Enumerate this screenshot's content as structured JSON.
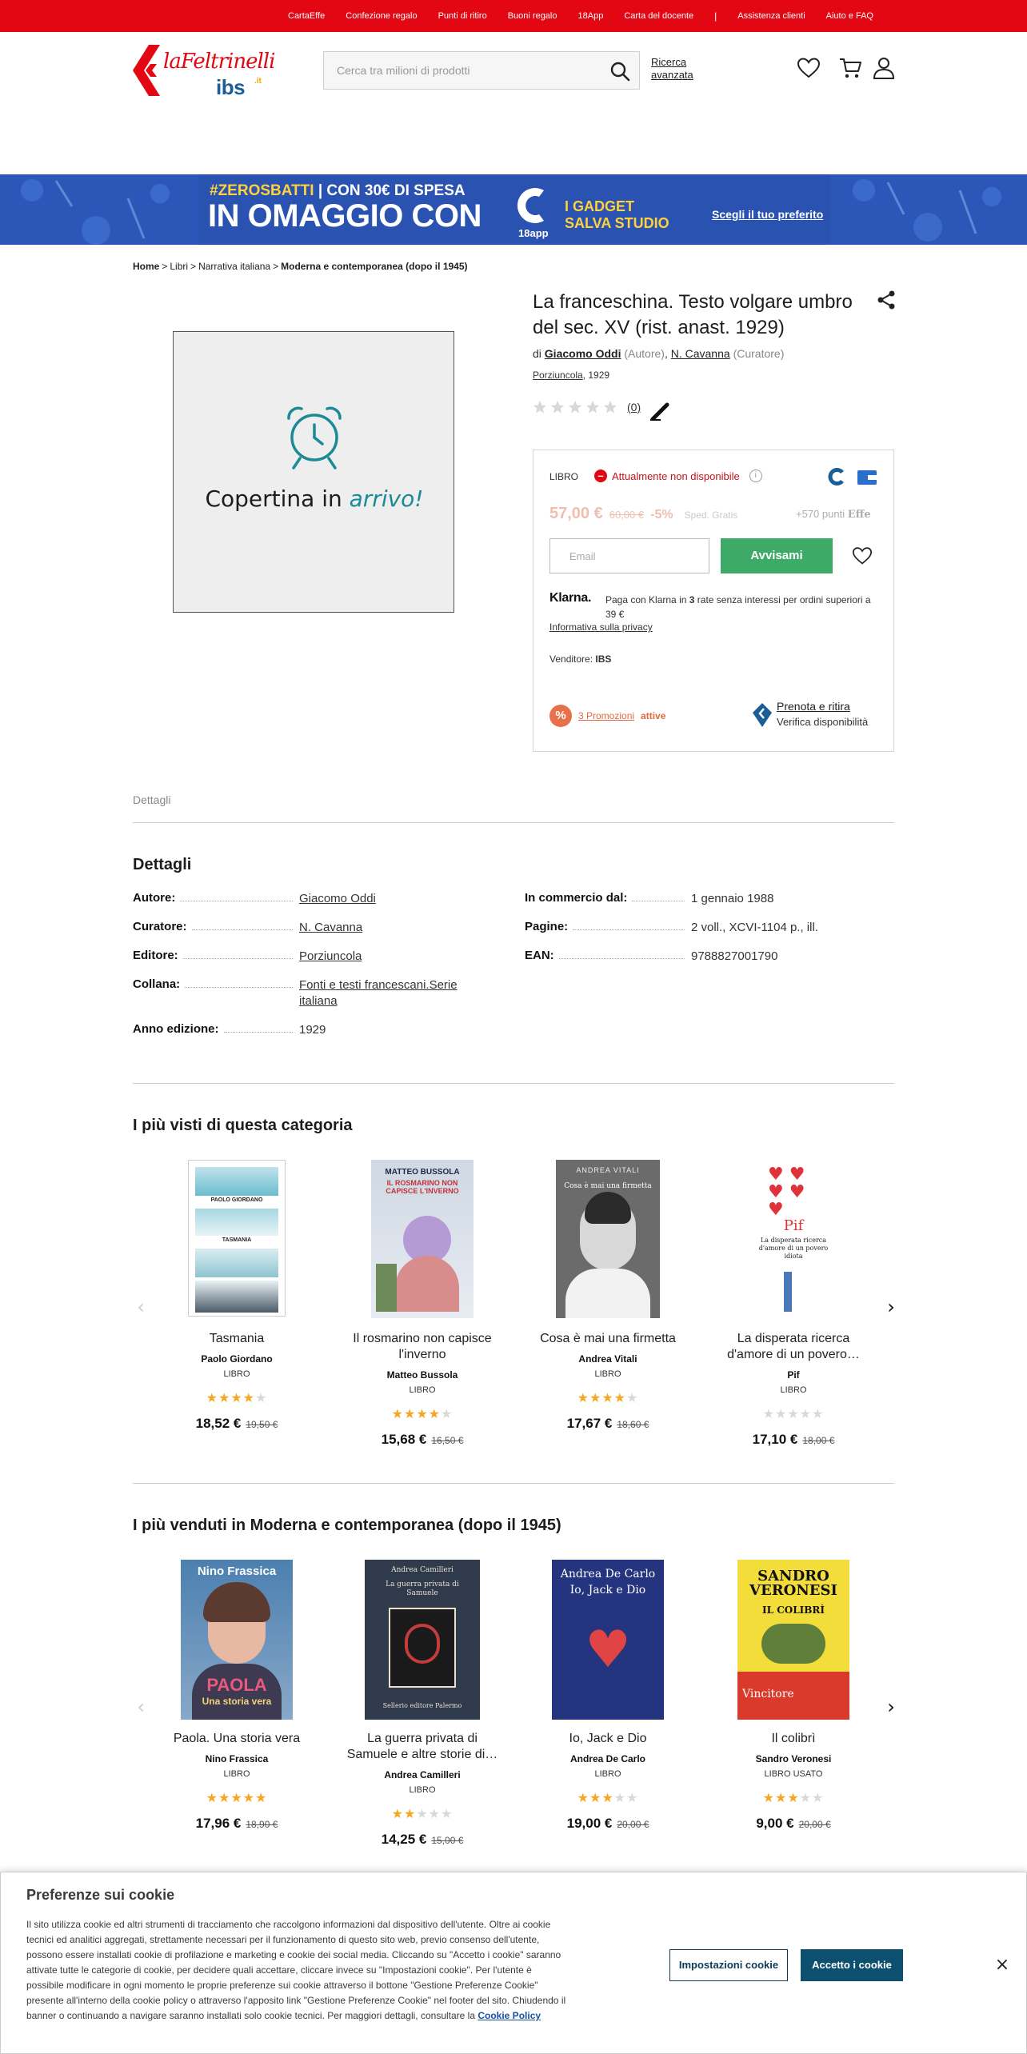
{
  "topbar": {
    "links": [
      "CartaEffe",
      "Confezione regalo",
      "Punti di ritiro",
      "Buoni regalo",
      "18App",
      "Carta del docente",
      "Assistenza clienti",
      "Aiuto e FAQ"
    ]
  },
  "header": {
    "logo_brand": "laFeltrinelli",
    "logo_sub": "ibs",
    "logo_tld": ".it",
    "search_placeholder": "Cerca tra milioni di prodotti",
    "advanced_line1": "Ricerca",
    "advanced_line2": "avanzata",
    "icons": [
      "heart-icon",
      "cart-icon",
      "user-icon"
    ]
  },
  "banner": {
    "tag_hash": "#ZEROSBATTI",
    "tag_rest": " | CON 30€ DI SPESA",
    "headline": "IN OMAGGIO CON",
    "app_label": "18app",
    "gadget_line1": "I GADGET",
    "gadget_line2": "SALVA STUDIO",
    "cta": "Scegli il tuo preferito"
  },
  "breadcrumb": {
    "items": [
      "Home",
      "Libri",
      "Narrativa italiana",
      "Moderna e contemporanea (dopo il 1945)"
    ]
  },
  "cover": {
    "placeholder_text": "Copertina in",
    "placeholder_em": "arrivo!"
  },
  "product": {
    "title": "La franceschina. Testo volgare umbro del sec. XV (rist. anast. 1929)",
    "by_prefix": "di",
    "author": "Giacomo Oddi",
    "author_role": "(Autore)",
    "curator": "N. Cavanna",
    "curator_role": "(Curatore)",
    "publisher": "Porziuncola",
    "year": ", 1929",
    "rating": 0,
    "review_count": "(0)"
  },
  "buybox": {
    "format": "LIBRO",
    "availability": "Attualmente non disponibile",
    "price": "57,00 €",
    "old_price": "60,00 €",
    "discount": "-5%",
    "shipping": "Sped. Gratis",
    "points": "+570",
    "points_label": "punti",
    "points_brand": "Effe",
    "email_placeholder": "Email",
    "notify_label": "Avvisami",
    "klarna_brand": "Klarna.",
    "klarna_text_a": "Paga con Klarna in ",
    "klarna_text_b": "3",
    "klarna_text_c": " rate senza interessi per ordini superiori a 39 €",
    "privacy_link": "Informativa sulla privacy",
    "seller_label": "Venditore:",
    "seller_name": "IBS",
    "promo_link": "3 Promozioni",
    "promo_active": "attive",
    "reserve_line1": "Prenota e ritira",
    "reserve_line2": "Verifica disponibilità"
  },
  "tabs": {
    "details_tab": "Dettagli"
  },
  "details": {
    "heading": "Dettagli",
    "left": [
      {
        "k": "Autore:",
        "v": "Giacomo Oddi",
        "link": true
      },
      {
        "k": "Curatore:",
        "v": "N. Cavanna",
        "link": true
      },
      {
        "k": "Editore:",
        "v": "Porziuncola",
        "link": true
      },
      {
        "k": "Collana:",
        "v": "Fonti e testi francescani.Serie italiana",
        "link": true
      },
      {
        "k": "Anno edizione:",
        "v": "1929",
        "link": false
      }
    ],
    "right": [
      {
        "k": "In commercio dal:",
        "v": "1 gennaio 1988"
      },
      {
        "k": "Pagine:",
        "v": "2 voll., XCVI-1104 p., ill."
      },
      {
        "k": "EAN:",
        "v": "9788827001790"
      }
    ]
  },
  "most_viewed": {
    "heading": "I più visti di questa categoria",
    "items": [
      {
        "title": "Tasmania",
        "author": "Paolo Giordano",
        "format": "LIBRO",
        "stars": 4,
        "price": "18,52 €",
        "old": "19,50 €",
        "cover_author": "PAOLO GIORDANO",
        "cover_title": "TASMANIA"
      },
      {
        "title": "Il rosmarino non capisce l'inverno",
        "author": "Matteo Bussola",
        "format": "LIBRO",
        "stars": 4,
        "price": "15,68 €",
        "old": "16,50 €",
        "cover_author": "MATTEO BUSSOLA",
        "cover_title": "IL ROSMARINO NON CAPISCE L'INVERNO"
      },
      {
        "title": "Cosa è mai una firmetta",
        "author": "Andrea Vitali",
        "format": "LIBRO",
        "stars": 4,
        "price": "17,67 €",
        "old": "18,60 €",
        "cover_author": "ANDREA VITALI",
        "cover_title": "Cosa è mai una firmetta"
      },
      {
        "title": "La disperata ricerca d'amore di un povero…",
        "author": "Pif",
        "format": "LIBRO",
        "stars": 0,
        "price": "17,10 €",
        "old": "18,00 €",
        "cover_author": "Pif",
        "cover_title": "La disperata ricerca d'amore di un povero idiota"
      }
    ]
  },
  "best_sellers": {
    "heading": "I più venduti in Moderna e contemporanea (dopo il 1945)",
    "items": [
      {
        "title": "Paola. Una storia vera",
        "author": "Nino Frassica",
        "format": "LIBRO",
        "stars": 5,
        "price": "17,96 €",
        "old": "18,90 €",
        "cover_author": "Nino Frassica",
        "cover_title": "PAOLA",
        "cover_sub": "Una storia vera"
      },
      {
        "title": "La guerra privata di Samuele e altre storie di…",
        "author": "Andrea Camilleri",
        "format": "LIBRO",
        "stars": 2,
        "price": "14,25 €",
        "old": "15,00 €",
        "cover_author": "Andrea Camilleri",
        "cover_title": "La guerra privata di Samuele",
        "cover_sub": "Sellerio editore Palermo"
      },
      {
        "title": "Io, Jack e Dio",
        "author": "Andrea De Carlo",
        "format": "LIBRO",
        "stars": 3,
        "price": "19,00 €",
        "old": "20,00 €",
        "cover_author": "Andrea De Carlo",
        "cover_title": "Io, Jack e Dio",
        "cover_sub": ""
      },
      {
        "title": "Il colibrì",
        "author": "Sandro Veronesi",
        "format": "LIBRO USATO",
        "stars": 3,
        "price": "9,00 €",
        "old": "20,00 €",
        "cover_author": "SANDRO VERONESI",
        "cover_title": "IL COLIBRÌ",
        "cover_sub": "Vincitore"
      }
    ]
  },
  "cookie": {
    "title": "Preferenze sui cookie",
    "body": "Il sito utilizza cookie ed altri strumenti di tracciamento che raccolgono informazioni dal dispositivo dell'utente. Oltre ai cookie tecnici ed analitici aggregati, strettamente necessari per il funzionamento di questo sito web, previo consenso dell'utente, possono essere installati cookie di profilazione e marketing e cookie dei social media. Cliccando su \"Accetto i cookie\" saranno attivate tutte le categorie di cookie, per decidere quali accettare, cliccare invece su \"Impostazioni cookie\". Per l'utente è possibile modificare in ogni momento le proprie preferenze sui cookie attraverso il bottone \"Gestione Preferenze Cookie\" presente all'interno della cookie policy o attraverso l'apposito link \"Gestione Preferenze Cookie\" nel footer del sito. Chiudendo il banner o continuando a navigare saranno installati solo cookie tecnici. Per maggiori dettagli, consultare la ",
    "policy_link": "Cookie Policy",
    "settings_btn": "Impostazioni cookie",
    "accept_btn": "Accetto i cookie",
    "close": "×"
  },
  "colors": {
    "brand_red": "#e30613",
    "ibs_blue": "#1a5e97",
    "accent_green": "#3daa68",
    "star": "#f5a623"
  }
}
